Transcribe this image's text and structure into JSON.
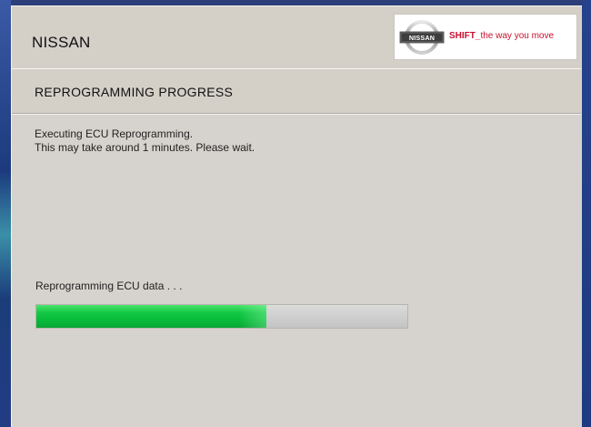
{
  "header": {
    "title": "NISSAN",
    "banner": {
      "logo_text": "NISSAN",
      "slogan_bold": "SHIFT_",
      "slogan_rest": "the way you move"
    }
  },
  "section": {
    "title": "REPROGRAMMING PROGRESS"
  },
  "content": {
    "message_line1": "Executing ECU Reprogramming.",
    "message_line2": "This may take around 1 minutes. Please wait.",
    "progress_label": "Reprogramming ECU data . . .",
    "progress_fraction": 0.62
  },
  "colors": {
    "progress_fill": "#12c844",
    "brand_red": "#c8102e",
    "panel_bg": "#d4d0c8"
  }
}
